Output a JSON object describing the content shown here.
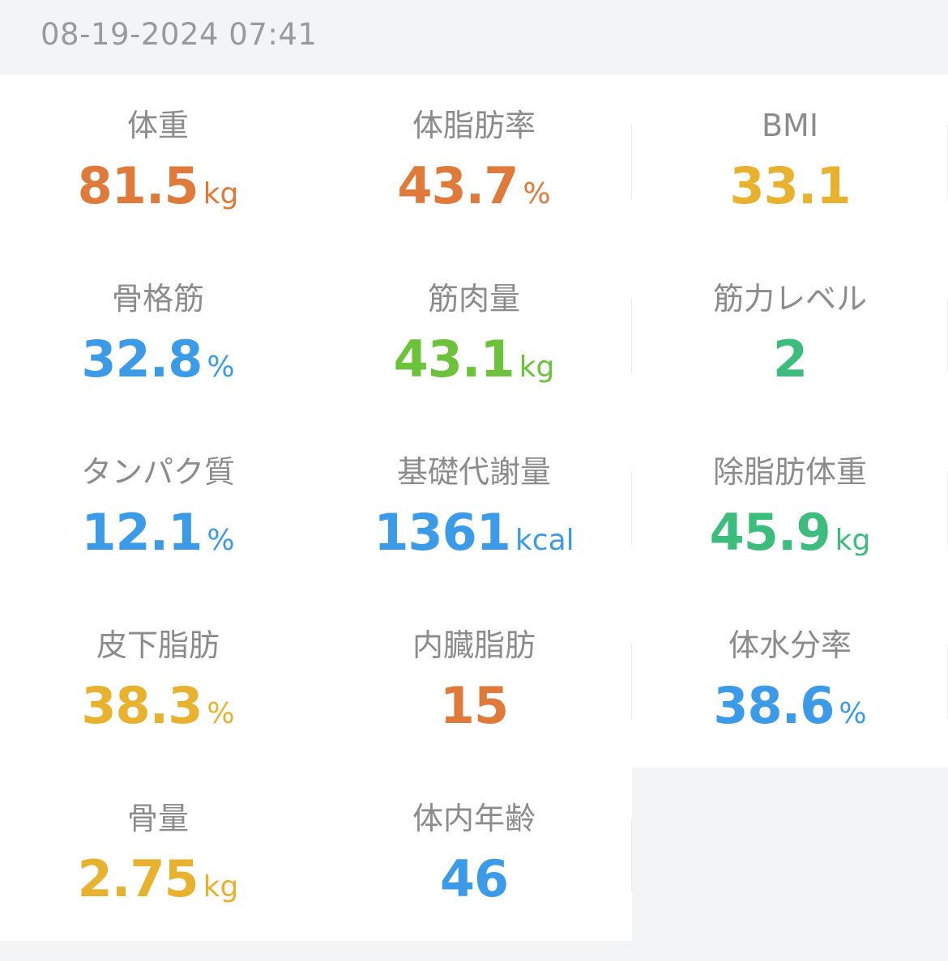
{
  "header": {
    "timestamp": "08-19-2024 07:41"
  },
  "colors": {
    "orange": "#e07a3a",
    "yellow": "#e8b12e",
    "blue": "#3c9be8",
    "green": "#6cc23a",
    "teal": "#3dbd7d",
    "label_gray": "#8c8c8c"
  },
  "metrics": [
    [
      {
        "label": "体重",
        "value": "81.5",
        "unit": "kg",
        "color": "#e07a3a"
      },
      {
        "label": "体脂肪率",
        "value": "43.7",
        "unit": "%",
        "color": "#e07a3a"
      },
      {
        "label": "BMI",
        "value": "33.1",
        "unit": "",
        "color": "#e8b12e"
      }
    ],
    [
      {
        "label": "骨格筋",
        "value": "32.8",
        "unit": "%",
        "color": "#3c9be8"
      },
      {
        "label": "筋肉量",
        "value": "43.1",
        "unit": "kg",
        "color": "#6cc23a"
      },
      {
        "label": "筋力レベル",
        "value": "2",
        "unit": "",
        "color": "#3dbd7d"
      }
    ],
    [
      {
        "label": "タンパク質",
        "value": "12.1",
        "unit": "%",
        "color": "#3c9be8"
      },
      {
        "label": "基礎代謝量",
        "value": "1361",
        "unit": "kcal",
        "color": "#3c9be8"
      },
      {
        "label": "除脂肪体重",
        "value": "45.9",
        "unit": "kg",
        "color": "#3dbd7d"
      }
    ],
    [
      {
        "label": "皮下脂肪",
        "value": "38.3",
        "unit": "%",
        "color": "#e8b12e"
      },
      {
        "label": "内臓脂肪",
        "value": "15",
        "unit": "",
        "color": "#e07a3a"
      },
      {
        "label": "体水分率",
        "value": "38.6",
        "unit": "%",
        "color": "#3c9be8"
      }
    ],
    [
      {
        "label": "骨量",
        "value": "2.75",
        "unit": "kg",
        "color": "#e8b12e"
      },
      {
        "label": "体内年齢",
        "value": "46",
        "unit": "",
        "color": "#3c9be8"
      }
    ]
  ]
}
